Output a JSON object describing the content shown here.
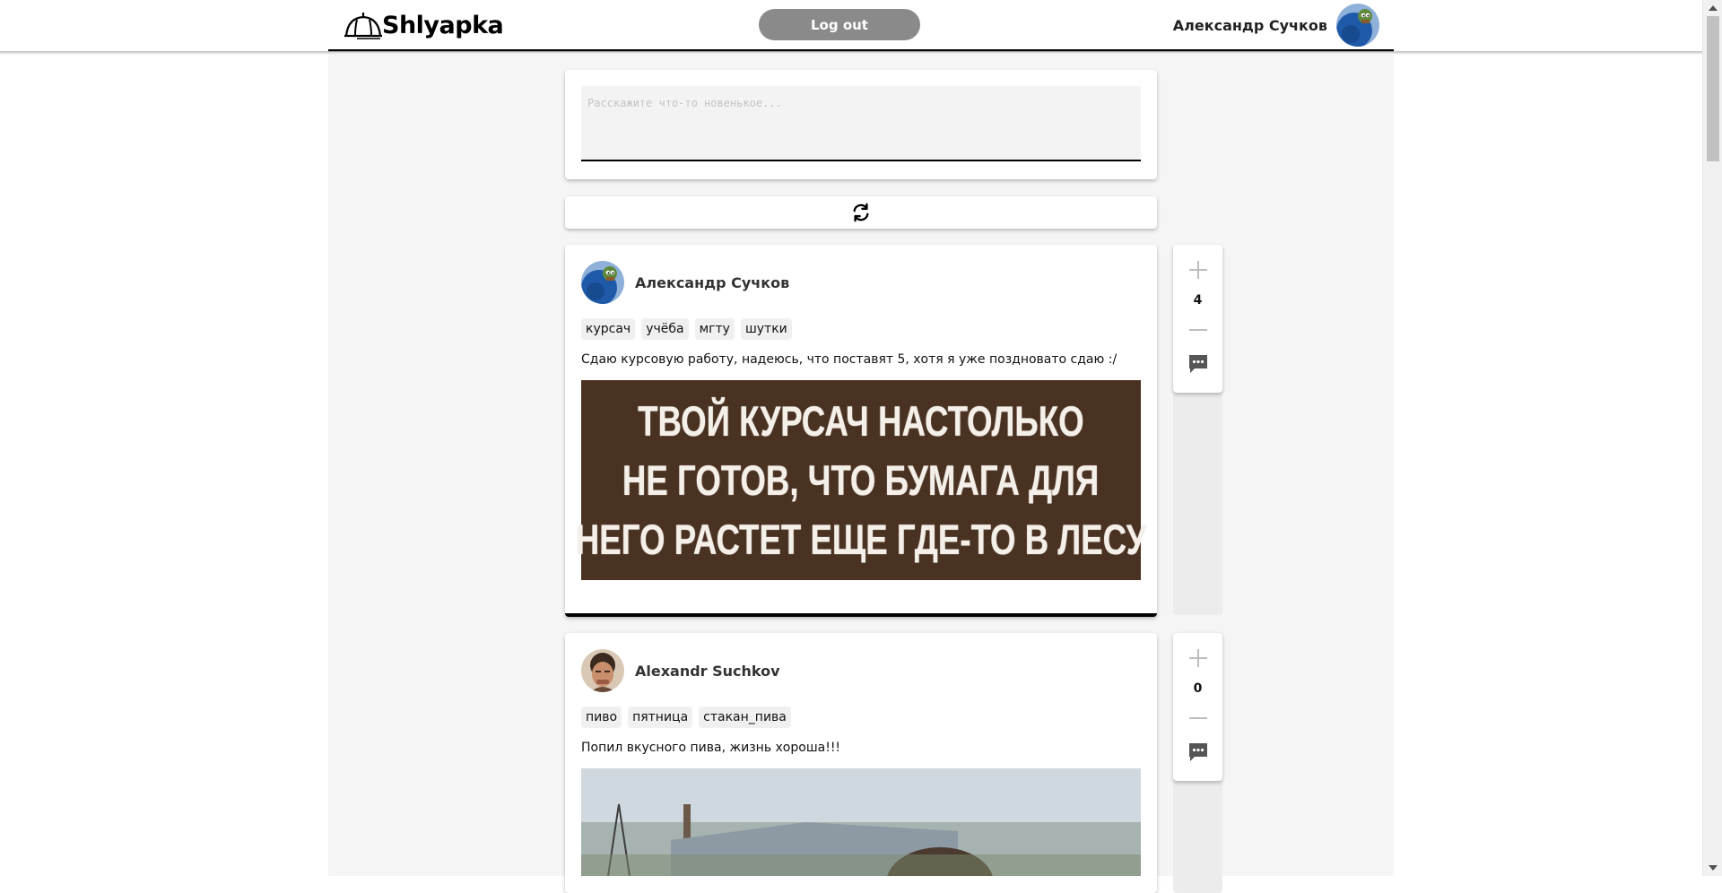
{
  "app": {
    "logo_text": "Shlyapka",
    "logout_label": "Log out",
    "current_user": "Александр Сучков"
  },
  "composer": {
    "placeholder": "Расскажите что-то новенькое..."
  },
  "refresh": {
    "icon": "refresh-icon"
  },
  "posts": [
    {
      "author": "Александр Сучков",
      "tags": [
        "курсач",
        "учёба",
        "мгту",
        "шутки"
      ],
      "text": "Сдаю курсовую работу, надеюсь, что поставят 5, хотя я уже поздновато сдаю :/",
      "image_lines": [
        "ТВОЙ КУРСАЧ НАСТОЛЬКО",
        "НЕ ГОТОВ, ЧТО БУМАГА ДЛЯ",
        "НЕГО РАСТЕТ ЕЩЕ ГДЕ-ТО В ЛЕСУ"
      ],
      "votes": "4"
    },
    {
      "author": "Alexandr Suchkov",
      "tags": [
        "пиво",
        "пятница",
        "стакан_пива"
      ],
      "text": "Попил вкусного пива, жизнь хороша!!!",
      "votes": "0"
    }
  ],
  "icons": {
    "vote_up": "plus-icon",
    "vote_down": "minus-icon",
    "comment": "comment-icon",
    "logo": "hat-icon"
  },
  "colors": {
    "logout_bg": "#8a8a8a",
    "meme_bg": "#4a3222",
    "avatar_blue": "#1f5aa8"
  }
}
